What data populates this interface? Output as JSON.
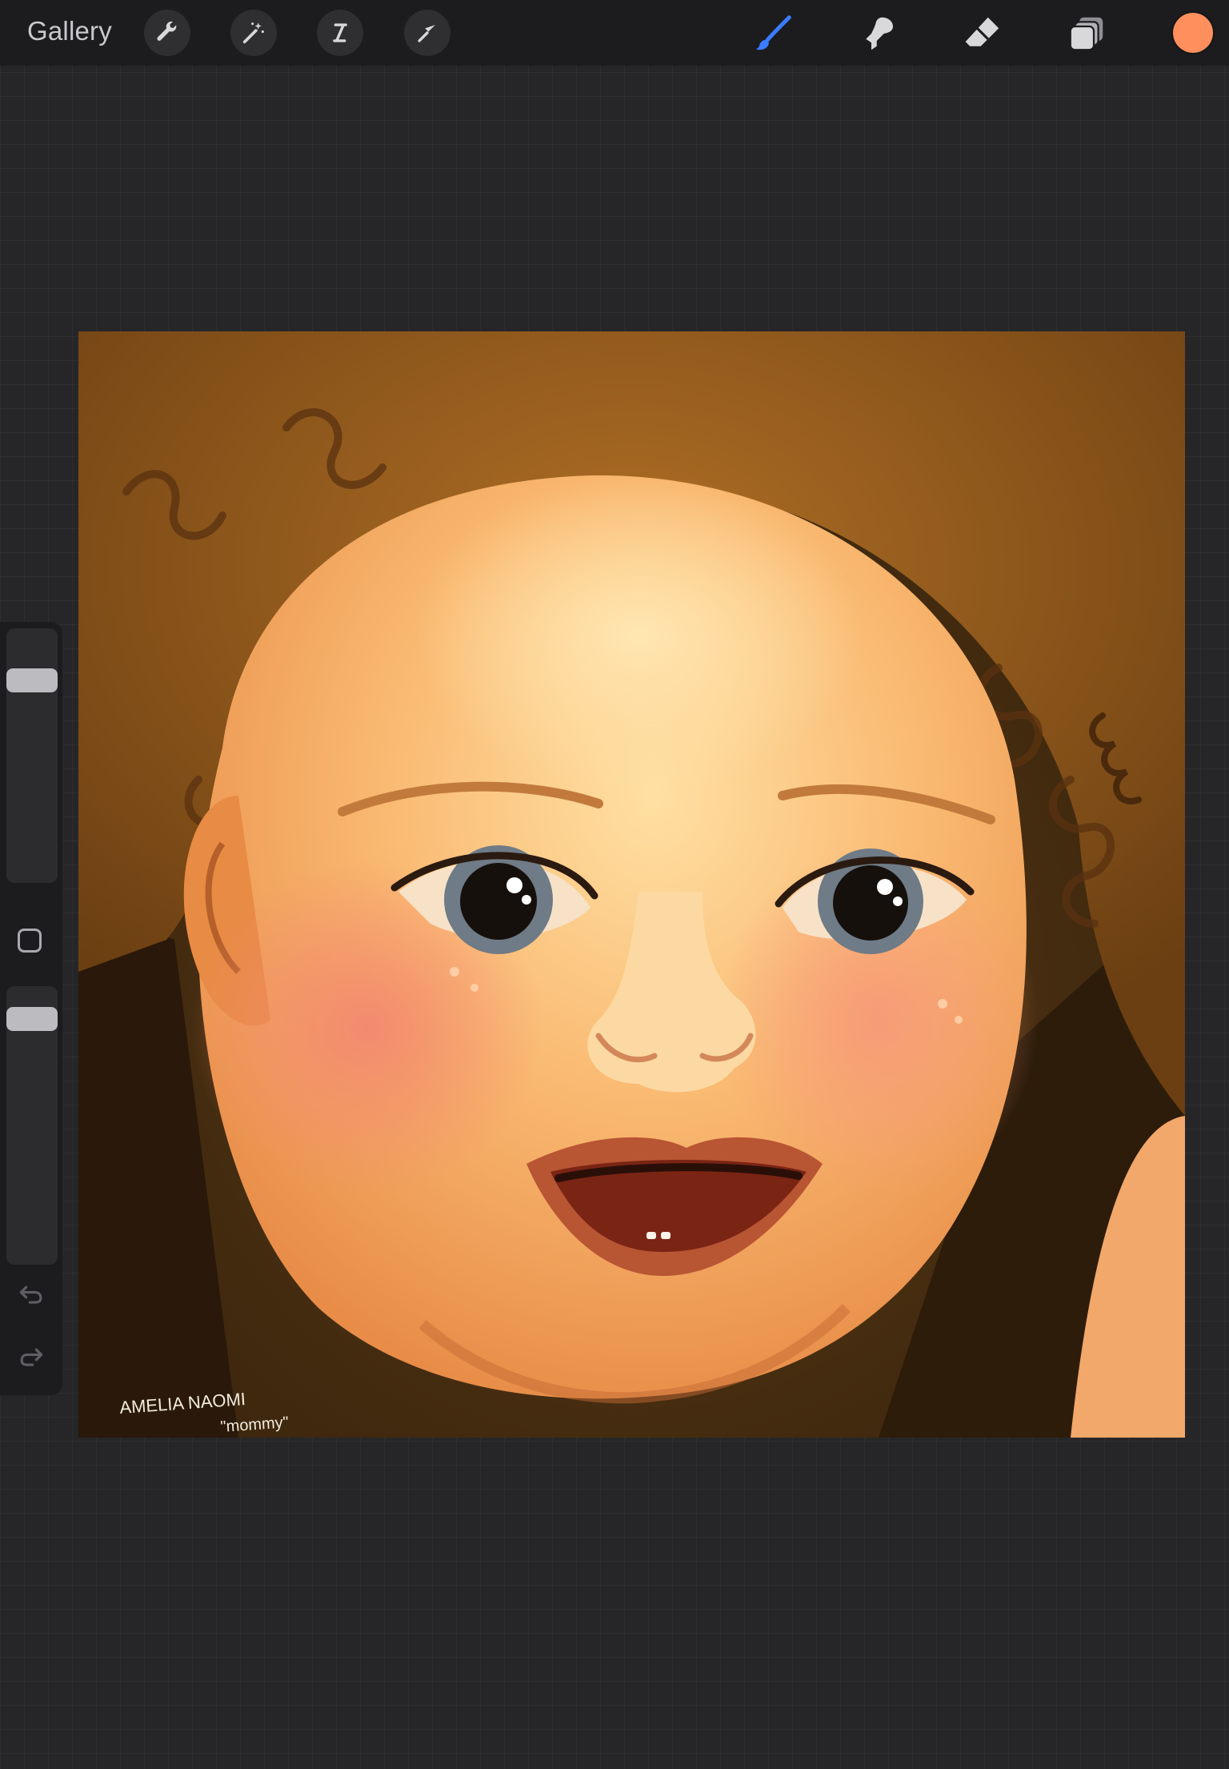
{
  "topbar": {
    "gallery_label": "Gallery",
    "left_tools": [
      {
        "name": "wrench-icon",
        "tooltip": "Actions"
      },
      {
        "name": "magic-wand-icon",
        "tooltip": "Adjustments"
      },
      {
        "name": "selection-icon",
        "tooltip": "Selection"
      },
      {
        "name": "transform-arrow-icon",
        "tooltip": "Transform"
      }
    ],
    "right_tools": [
      {
        "name": "brush-icon",
        "active": true
      },
      {
        "name": "smudge-icon",
        "active": false
      },
      {
        "name": "eraser-icon",
        "active": false
      },
      {
        "name": "layers-icon",
        "active": false
      }
    ],
    "current_color": "#FF8F5C",
    "active_tool_color": "#3A7BFF"
  },
  "sidebar": {
    "brush_size_level": 0.82,
    "opacity_level": 0.92,
    "icons": [
      "modifier-square-icon",
      "undo-icon",
      "redo-icon"
    ]
  },
  "canvas": {
    "signature_text": "AMELIA NAOMI",
    "signature_title": "\"mommy\""
  }
}
